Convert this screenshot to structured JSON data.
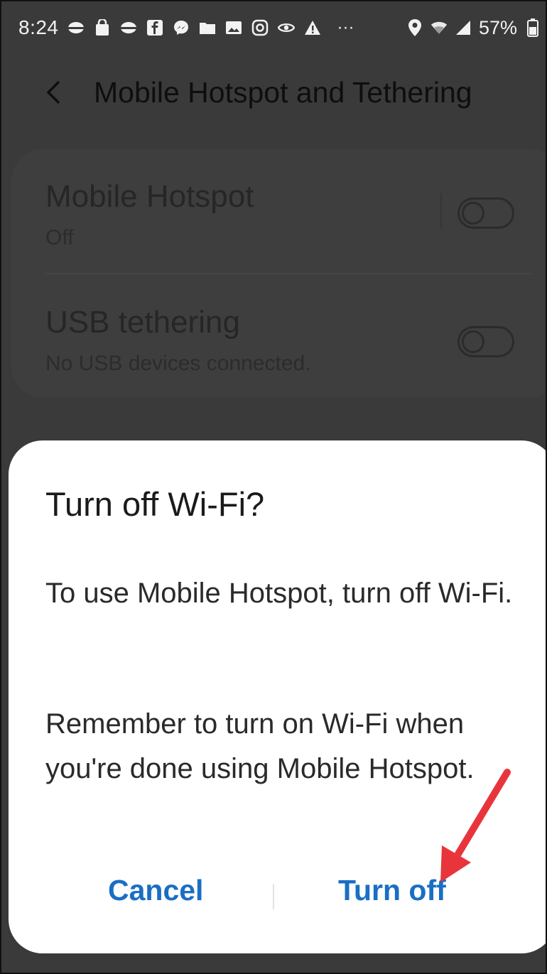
{
  "status_bar": {
    "time": "8:24",
    "more": "···",
    "battery": "57%",
    "icons": [
      "pokeball-icon",
      "shopping-bag-icon",
      "pokeball-icon",
      "facebook-icon",
      "messenger-icon",
      "folder-icon",
      "image-icon",
      "instagram-icon",
      "eye-icon",
      "warning-icon"
    ],
    "right_icons": [
      "location-icon",
      "wifi-icon",
      "signal-icon",
      "battery-icon"
    ]
  },
  "app_bar": {
    "title": "Mobile Hotspot and Tethering",
    "back_icon": "chevron-left-icon"
  },
  "settings": {
    "items": [
      {
        "title": "Mobile Hotspot",
        "subtitle": "Off",
        "toggle_on": false
      },
      {
        "title": "USB tethering",
        "subtitle": "No USB devices connected.",
        "toggle_on": false
      }
    ]
  },
  "dialog": {
    "title": "Turn off Wi-Fi?",
    "message": "To use Mobile Hotspot, turn off Wi-Fi.",
    "message2": "Remember to turn on Wi-Fi when you're done using Mobile Hotspot.",
    "cancel_label": "Cancel",
    "confirm_label": "Turn off"
  },
  "colors": {
    "overlay": "#3a3a3a",
    "dialog_bg": "#ffffff",
    "accent": "#1a6ec4",
    "annotation_arrow": "#e8353c"
  }
}
